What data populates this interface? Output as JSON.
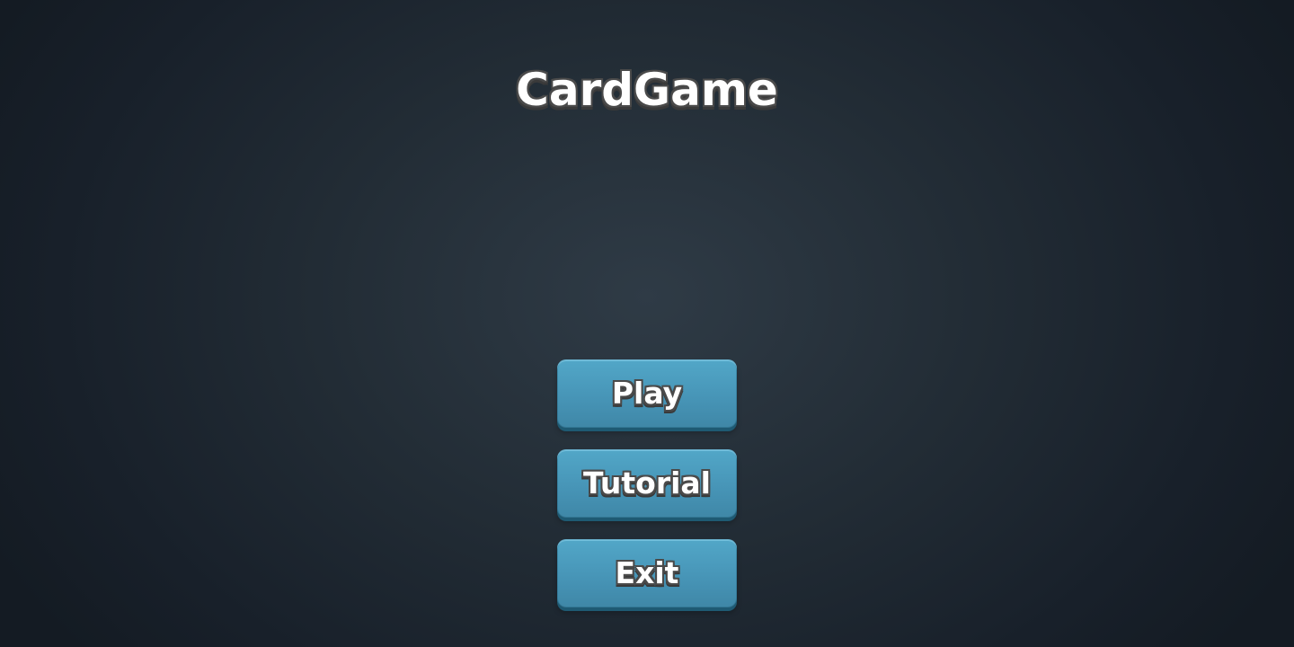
{
  "game": {
    "title": "CardGame"
  },
  "menu": {
    "buttons": [
      {
        "label": "Play"
      },
      {
        "label": "Tutorial"
      },
      {
        "label": "Exit"
      }
    ]
  },
  "colors": {
    "background_center": "#2f3b46",
    "background_edge": "#141b23",
    "button_top": "#52a7c8",
    "button_bottom": "#3f87a7",
    "button_shadow": "#1e5a73",
    "text": "#ffffff",
    "text_outline": "#4a4a4a"
  }
}
